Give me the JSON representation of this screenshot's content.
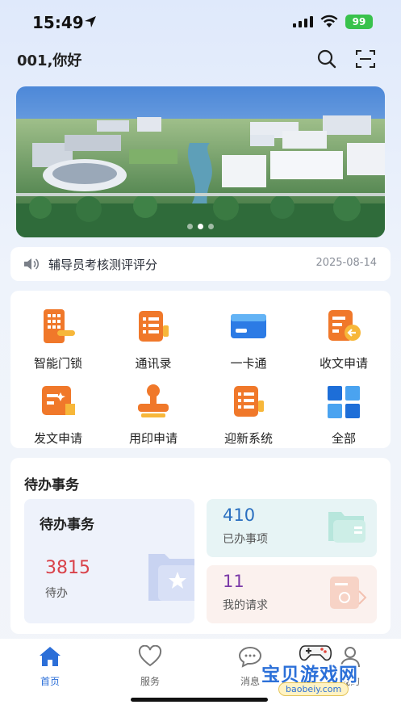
{
  "status_bar": {
    "time": "15:49",
    "battery": "99"
  },
  "header": {
    "greeting": "001,你好"
  },
  "notice": {
    "title": "辅导员考核测评评分",
    "date": "2025-08-14"
  },
  "grid": [
    {
      "label": "智能门锁",
      "icon": "door-lock-icon"
    },
    {
      "label": "通讯录",
      "icon": "contacts-icon"
    },
    {
      "label": "一卡通",
      "icon": "campus-card-icon"
    },
    {
      "label": "收文申请",
      "icon": "incoming-document-icon"
    },
    {
      "label": "发文申请",
      "icon": "outgoing-document-icon"
    },
    {
      "label": "用印申请",
      "icon": "seal-stamp-icon"
    },
    {
      "label": "迎新系统",
      "icon": "orientation-system-icon"
    },
    {
      "label": "全部",
      "icon": "all-apps-icon"
    }
  ],
  "todo": {
    "section_title": "待办事务",
    "main": {
      "title": "待办事务",
      "count": "3815",
      "label": "待办"
    },
    "done": {
      "count": "410",
      "label": "已办事项"
    },
    "requests": {
      "count": "11",
      "label": "我的请求"
    }
  },
  "tabbar": [
    {
      "label": "首页",
      "icon": "home-icon",
      "active": true
    },
    {
      "label": "服务",
      "icon": "heart-icon",
      "active": false
    },
    {
      "label": "消息",
      "icon": "message-icon",
      "active": false
    },
    {
      "label": "我的",
      "icon": "profile-icon",
      "active": false
    }
  ],
  "watermark": {
    "text": "宝贝游戏网",
    "url": "baobeiy.com"
  },
  "colors": {
    "accent": "#2c6fd8",
    "todo_count": "#d9424a",
    "done_count": "#2a6fc0",
    "request_count": "#7b3aa8",
    "icon_orange": "#f0782a"
  }
}
